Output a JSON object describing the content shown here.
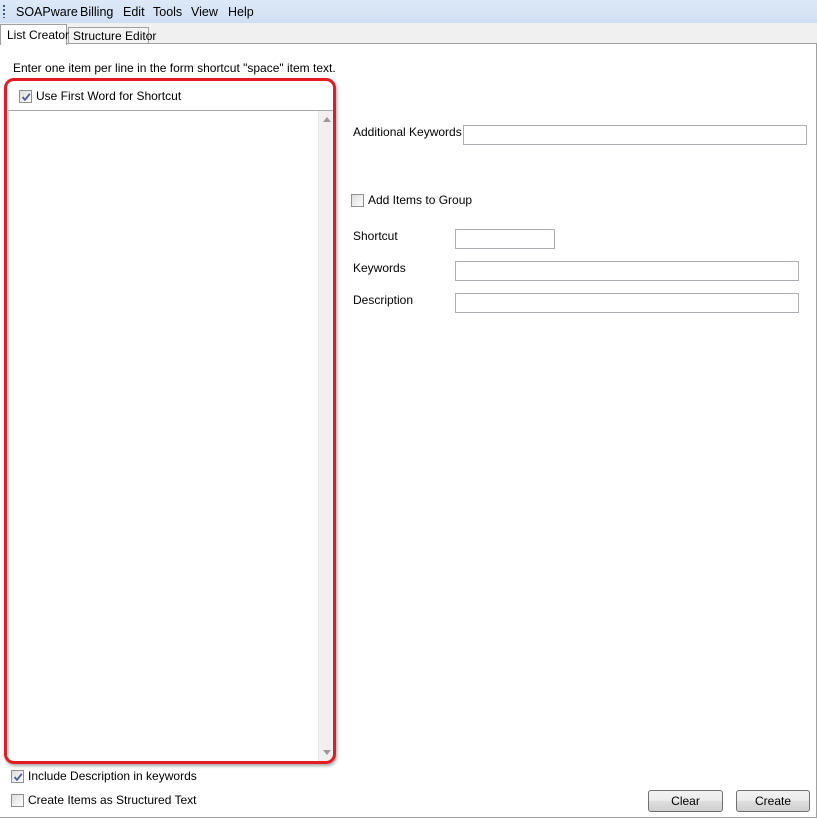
{
  "menu": [
    "SOAPware",
    "Billing",
    "Edit",
    "Tools",
    "View",
    "Help"
  ],
  "tabs": {
    "active": "List Creator",
    "inactive": "Structure Editor"
  },
  "instructions": "Enter one item per line in the form shortcut \"space\" item text.",
  "left": {
    "use_first_word": {
      "label": "Use First Word for Shortcut",
      "checked": true
    },
    "list_value": ""
  },
  "right": {
    "additional_keywords": {
      "label": "Additional Keywords",
      "value": ""
    },
    "add_items_to_group": {
      "label": "Add Items to Group",
      "checked": false
    },
    "shortcut": {
      "label": "Shortcut",
      "value": ""
    },
    "keywords": {
      "label": "Keywords",
      "value": ""
    },
    "description": {
      "label": "Description",
      "value": ""
    }
  },
  "bottom": {
    "include_description": {
      "label": "Include Description in keywords",
      "checked": true
    },
    "create_structured": {
      "label": "Create Items as Structured Text",
      "checked": false
    },
    "clear_label": "Clear",
    "create_label": "Create"
  },
  "colors": {
    "highlight": "#e31b23",
    "menubar": "#d8e6f6"
  }
}
